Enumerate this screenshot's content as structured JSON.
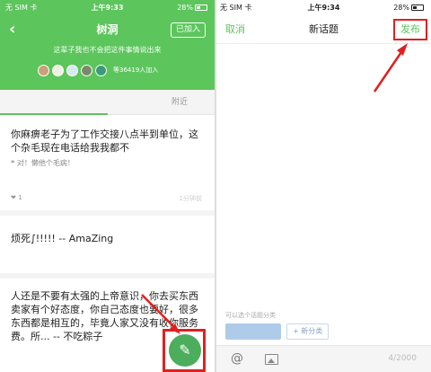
{
  "left": {
    "status": {
      "carrier": "无 SIM 卡",
      "time": "上午9:33",
      "battery": "28%"
    },
    "title": "树洞",
    "joined_label": "已加入",
    "slogan": "这辈子我也不会把这件事情说出来",
    "member_count": "等36419人加入",
    "tab_recent": "附近",
    "posts": [
      {
        "text": "你麻痹老子为了工作交接八点半到单位，这个杂毛现在电话给我我都不",
        "quote": "对！懒他个毛病！",
        "likes": "1",
        "time": "1分钟前"
      },
      {
        "text": "烦死∫!!!!! -- AmaZing"
      },
      {
        "text": "人还是不要有太强的上帝意识，你去买东西卖家有个好态度，你自己态度也要好，很多东西都是相互的，毕竟人家又没有收你服务费。所... -- 不吃粽子"
      }
    ],
    "fab_icon": "pencil-icon"
  },
  "right": {
    "status": {
      "carrier": "无 SIM 卡",
      "time": "上午9:34",
      "battery": "28%"
    },
    "cancel": "取消",
    "title": "新话题",
    "publish": "发布",
    "category_hint": "可以选个话题分类",
    "add_category": "+ 新分类",
    "counter": "4/2000"
  },
  "colors": {
    "brand_green": "#5cc55c",
    "highlight_red": "#e02020"
  }
}
